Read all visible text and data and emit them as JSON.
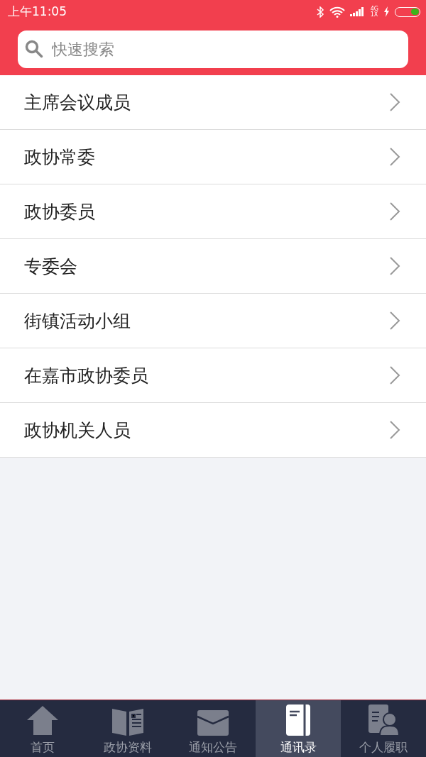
{
  "status_bar": {
    "time": "上午11:05",
    "network_top": "4G",
    "network_bottom": "1X",
    "battery": {
      "level": 0.35
    }
  },
  "search": {
    "placeholder": "快速搜索"
  },
  "list": [
    {
      "label": "主席会议成员"
    },
    {
      "label": "政协常委"
    },
    {
      "label": "政协委员"
    },
    {
      "label": "专委会"
    },
    {
      "label": "街镇活动小组"
    },
    {
      "label": "在嘉市政协委员"
    },
    {
      "label": "政协机关人员"
    }
  ],
  "tab_bar": [
    {
      "label": "首页",
      "selected": false
    },
    {
      "label": "政协资料",
      "selected": false
    },
    {
      "label": "通知公告",
      "selected": false
    },
    {
      "label": "通讯录",
      "selected": true
    },
    {
      "label": "个人履职",
      "selected": false
    }
  ]
}
